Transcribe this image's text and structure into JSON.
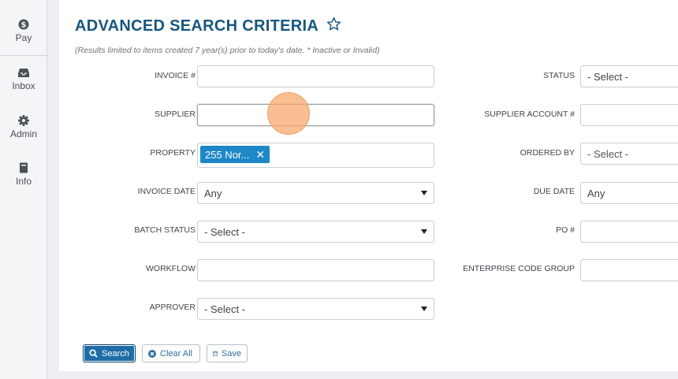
{
  "nav": {
    "items": [
      {
        "label": "Pay",
        "icon": "dollar-circle-icon"
      },
      {
        "label": "Inbox",
        "icon": "inbox-icon"
      },
      {
        "label": "Admin",
        "icon": "gear-icon"
      },
      {
        "label": "Info",
        "icon": "book-icon"
      }
    ]
  },
  "header": {
    "title": "ADVANCED SEARCH CRITERIA",
    "favorite_icon": "star-outline-icon"
  },
  "note": "(Results limited to items created 7 year(s) prior to today's date. * Inactive or Invalid)",
  "left_fields": {
    "invoice_number": {
      "label": "INVOICE #",
      "value": ""
    },
    "supplier": {
      "label": "SUPPLIER",
      "value": ""
    },
    "property": {
      "label": "PROPERTY",
      "chip": "255 Nor...",
      "chip_remove": "✕"
    },
    "invoice_date": {
      "label": "INVOICE DATE",
      "value": "Any"
    },
    "batch_status": {
      "label": "BATCH STATUS",
      "value": "- Select -"
    },
    "workflow": {
      "label": "WORKFLOW",
      "value": ""
    },
    "approver": {
      "label": "APPROVER",
      "value": "- Select -"
    }
  },
  "right_fields": {
    "status": {
      "label": "STATUS",
      "value": "- Select -"
    },
    "supplier_account": {
      "label": "SUPPLIER ACCOUNT #",
      "value": ""
    },
    "ordered_by": {
      "label": "ORDERED BY",
      "value": "- Select -"
    },
    "due_date": {
      "label": "DUE DATE",
      "value": "Any"
    },
    "po_number": {
      "label": "PO #",
      "value": ""
    },
    "enterprise_code_group": {
      "label": "ENTERPRISE CODE GROUP",
      "value": ""
    }
  },
  "actions": {
    "search": "Search",
    "clear_all": "Clear All",
    "save": "Save"
  },
  "colors": {
    "accent": "#1e6da6",
    "title": "#17567e",
    "chip": "#1d87c7",
    "touch_indicator": "#f7a86e"
  }
}
